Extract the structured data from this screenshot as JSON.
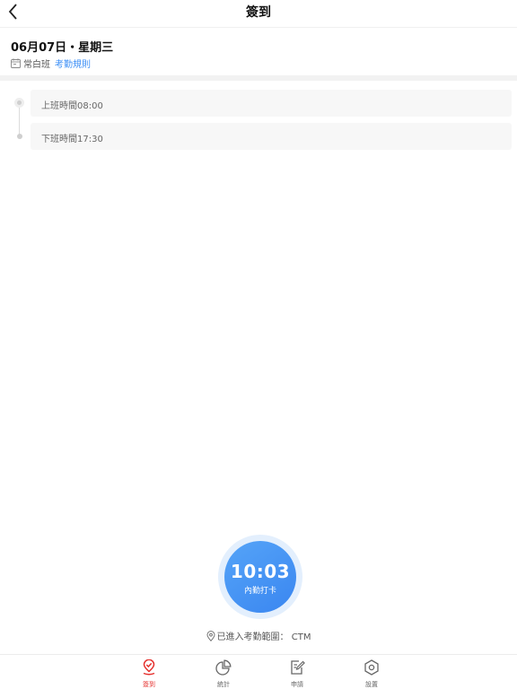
{
  "header": {
    "title": "簽到"
  },
  "date_block": {
    "date": "06月07日・星期三",
    "shift_name": "常白班",
    "rule_link": "考勤規則"
  },
  "timeline": [
    {
      "label": "上班時間08:00"
    },
    {
      "label": "下班時間17:30"
    }
  ],
  "punch": {
    "time": "10:03",
    "label": "內勤打卡"
  },
  "location": {
    "text": "已進入考勤範圍： CTM"
  },
  "tabs": [
    {
      "label": "簽到",
      "icon": "location-pin-check-icon",
      "active": true
    },
    {
      "label": "統計",
      "icon": "pie-chart-icon",
      "active": false
    },
    {
      "label": "申請",
      "icon": "edit-document-icon",
      "active": false
    },
    {
      "label": "設置",
      "icon": "settings-hexagon-icon",
      "active": false
    }
  ],
  "colors": {
    "accent": "#3a8ef6",
    "active_tab": "#e5312e",
    "punch_button": "#3a86f0"
  }
}
